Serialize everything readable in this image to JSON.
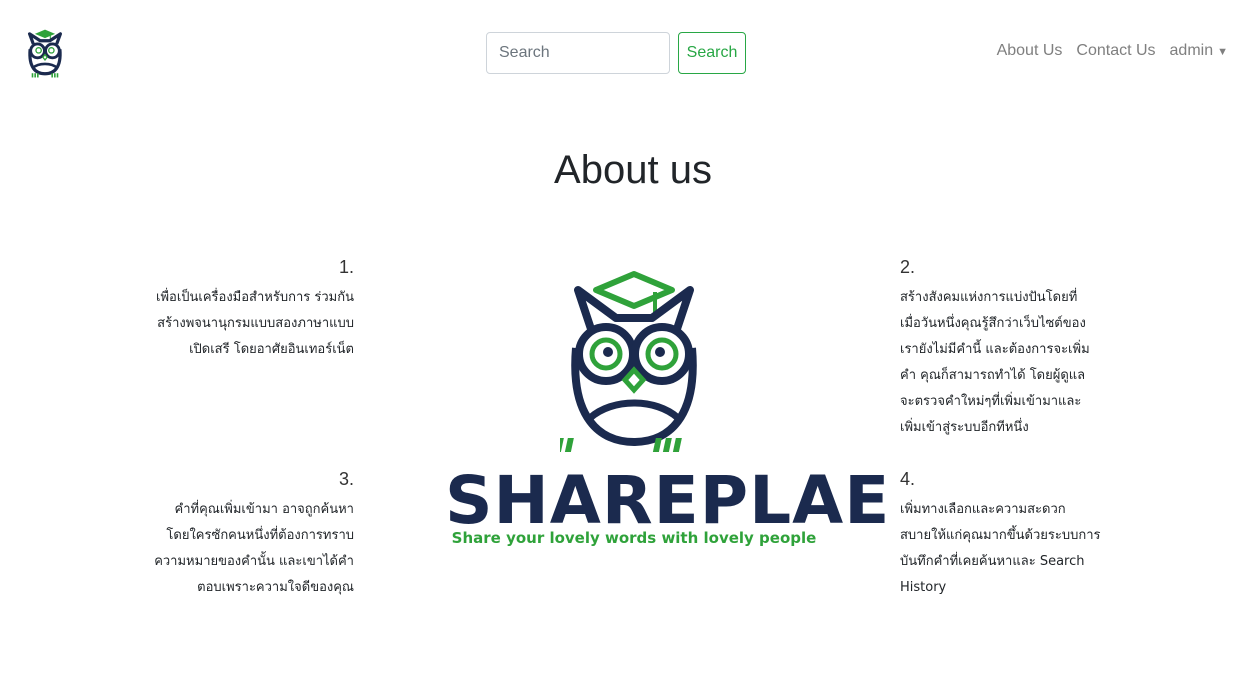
{
  "nav": {
    "search": {
      "placeholder": "Search",
      "button": "Search"
    },
    "links": [
      "About Us",
      "Contact Us"
    ],
    "user": "admin"
  },
  "page_title": "About us",
  "items": [
    {
      "number": "1.",
      "lines": [
        "เพื่อเป็นเครื่องมือสำหรับการ ร่วมกัน",
        "สร้างพจนานุกรมแบบสองภาษาแบบ",
        "เปิดเสรี โดยอาศัยอินเทอร์เน็ต"
      ]
    },
    {
      "number": "2.",
      "lines": [
        "สร้างสังคมแห่งการแบ่งปันโดยที่",
        "เมื่อวันหนึ่งคุณรู้สึกว่าเว็บไซต์ของ",
        "เรายังไม่มีคำนี้ และต้องการจะเพิ่ม",
        "คำ คุณก็สามารถทำได้ โดยผู้ดูแล",
        "จะตรวจคำใหม่ๆที่เพิ่มเข้ามาและ",
        "เพิ่มเข้าสู่ระบบอีกทีหนึ่ง"
      ]
    },
    {
      "number": "3.",
      "lines": [
        "คำที่คุณเพิ่มเข้ามา อาจถูกค้นหา",
        "โดยใครซักคนหนึ่งที่ต้องการทราบ",
        "ความหมายของคำนั้น และเขาได้คำ",
        "ตอบเพราะความใจดีของคุณ"
      ]
    },
    {
      "number": "4.",
      "lines": [
        "เพิ่มทางเลือกและความสะดวก",
        "สบายให้แก่คุณมากขึ้นด้วยระบบการ",
        "บันทึกคำที่เคยค้นหาและ Search",
        "History"
      ]
    }
  ],
  "brand": {
    "name": "SHAREPLAE",
    "tagline": "Share your lovely words with lovely people"
  },
  "colors": {
    "navy": "#1b2a4e",
    "green": "#2fa23a",
    "button_green": "#28a745",
    "link_gray": "#7f7f7f"
  }
}
